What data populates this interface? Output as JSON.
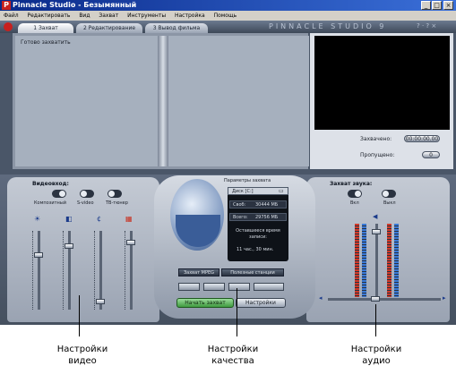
{
  "window": {
    "title": "Pinnacle Studio - Безымянный",
    "buttons": [
      "_",
      "□",
      "×"
    ]
  },
  "menu": [
    "Файл",
    "Редактировать",
    "Вид",
    "Захват",
    "Инструменты",
    "Настройка",
    "Помощь"
  ],
  "tabs": [
    {
      "label": "1 Захват",
      "active": true
    },
    {
      "label": "2 Редактирование",
      "active": false
    },
    {
      "label": "3 Вывод фильма",
      "active": false
    }
  ],
  "brand": "PINNACLE STUDIO 9",
  "help_glyphs": "? · ? ×",
  "album": {
    "label": "Готово захватить"
  },
  "preview": {
    "status_label": "Захвачено:",
    "status_value": "00:00:00.00",
    "dropped_label": "Пропущено:",
    "dropped_value": "0"
  },
  "video": {
    "title": "Видеовход:",
    "sources": [
      "Композитный",
      "S-video",
      "ТВ-тюнер"
    ],
    "slider_icons": [
      "☀",
      "◧",
      "¢",
      "▦"
    ]
  },
  "quality": {
    "header": "Параметры захвата",
    "disk": "Диск [С:]",
    "free_label": "Своб:",
    "free_value": "30444 МБ",
    "total_label": "Всего:",
    "total_value": "29756 МБ",
    "remaining_label": "Оставшееся время записи:",
    "remaining_value": "11 час., 30 мин.",
    "mode_label": "Захват MPEG",
    "mode_value": "Полезные станции",
    "start_label": "Начать захват",
    "settings_label": "Настройки"
  },
  "audio": {
    "title": "Захват звука:",
    "toggles": [
      "Вкл",
      "Выкл"
    ]
  },
  "captions": [
    {
      "line1": "Настройки",
      "line2": "видео"
    },
    {
      "line1": "Настройки",
      "line2": "качества"
    },
    {
      "line1": "Настройки",
      "line2": "аудио"
    }
  ],
  "colors": {
    "start_button": "#4faa4f",
    "title_bar": "#0a2a8a",
    "panel": "#4a5668"
  }
}
